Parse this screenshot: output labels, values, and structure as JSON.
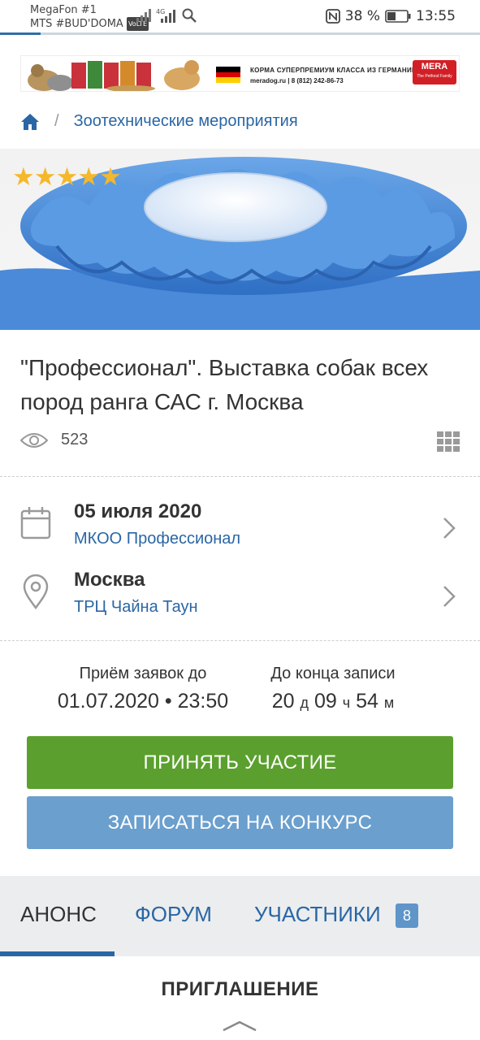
{
  "status_bar": {
    "carrier1": "MegaFon #1",
    "carrier2": "MTS #BUD'DOMA",
    "volte": "VoLTE",
    "network": "4G",
    "battery": "38 %",
    "time": "13:55"
  },
  "ad": {
    "text1": "КОРМА СУПЕРПРЕМИУМ КЛАССА ИЗ ГЕРМАНИИ",
    "text2": "meradog.ru | 8 (812) 242-86-73",
    "logo": "MERA",
    "logo_tagline": "The Petfood Family"
  },
  "breadcrumb": {
    "home_icon": "home-icon",
    "separator": "/",
    "item": "Зоотехнические мероприятия"
  },
  "hero": {
    "stars": "★★★★★",
    "rating": 5
  },
  "event": {
    "title": "\"Профессионал\". Выставка собак всех пород ранга САС г. Москва",
    "views": "523"
  },
  "date_row": {
    "date": "05 июля 2020",
    "organizer": "МКОО Профессионал"
  },
  "location_row": {
    "city": "Москва",
    "venue": "ТРЦ Чайна Таун"
  },
  "deadline": {
    "label": "Приём заявок до",
    "value": "01.07.2020 • 23:50"
  },
  "countdown": {
    "label": "До конца записи",
    "days": "20",
    "days_unit": "д",
    "hours": "09",
    "hours_unit": "ч",
    "minutes": "54",
    "minutes_unit": "м"
  },
  "buttons": {
    "participate": "ПРИНЯТЬ УЧАСТИЕ",
    "contest": "ЗАПИСАТЬСЯ НА КОНКУРС"
  },
  "tabs": [
    {
      "label": "АНОНС",
      "active": true
    },
    {
      "label": "ФОРУМ",
      "active": false
    },
    {
      "label": "УЧАСТНИКИ",
      "active": false,
      "badge": "8"
    }
  ],
  "section": {
    "title": "ПРИГЛАШЕНИЕ"
  },
  "colors": {
    "link": "#2a66a4",
    "primary_button": "#5ba02e",
    "secondary_button": "#6a9fce",
    "star": "#f5b82c"
  }
}
